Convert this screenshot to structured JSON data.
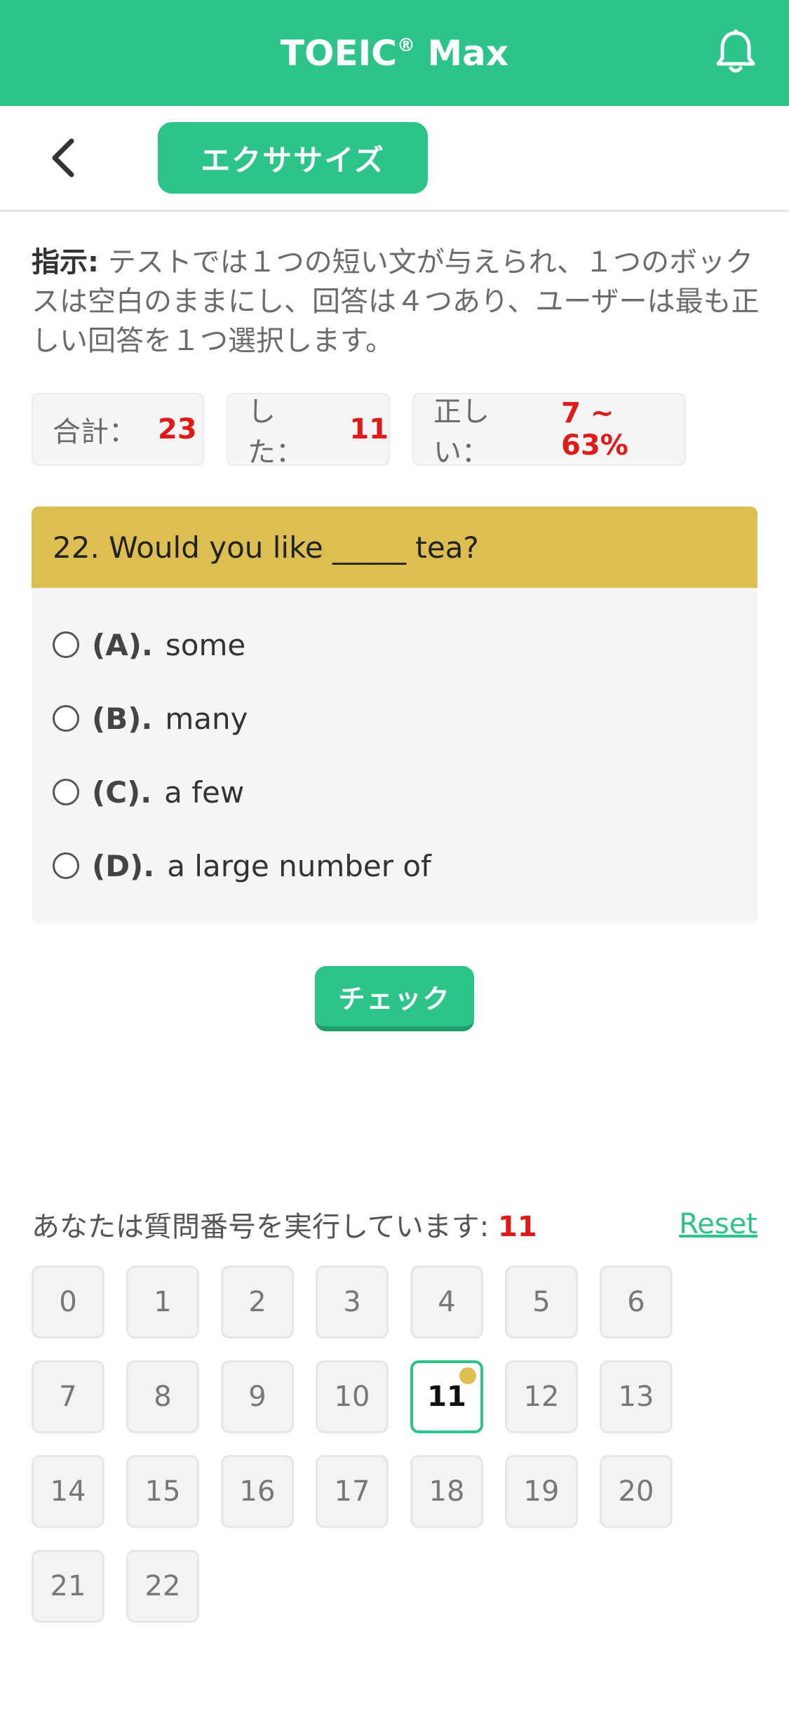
{
  "colors": {
    "brand": "#2dc48a",
    "accent": "#dcbf50",
    "highlight": "#e01919"
  },
  "header": {
    "title": "TOEIC",
    "title_reg": "®",
    "title_suffix": " Max",
    "bell_icon": "bell-icon"
  },
  "subheader": {
    "back_icon": "chevron-left-icon",
    "exercise_label": "エクササイズ"
  },
  "instruction": {
    "label": "指示:",
    "text": " テストでは１つの短い文が与えられ、１つのボックスは空白のままにし、回答は４つあり、ユーザーは最も正しい回答を１つ選択します。"
  },
  "stats": {
    "total_label": "合計：",
    "total_value": "23",
    "done_label": "した：",
    "done_value": "11",
    "correct_label": "正しい：",
    "correct_value": "7 ~ 63%"
  },
  "question": {
    "text": "22. Would you like _____ tea?",
    "options": [
      {
        "letter": "(A).",
        "text": "some"
      },
      {
        "letter": "(B).",
        "text": "many"
      },
      {
        "letter": "(C).",
        "text": "a few"
      },
      {
        "letter": "(D).",
        "text": "a large number of"
      }
    ]
  },
  "check_label": "チェック",
  "progress": {
    "label": "あなたは質問番号を実行しています: ",
    "current": "11",
    "reset_label": "Reset"
  },
  "questions_grid": [
    "0",
    "1",
    "2",
    "3",
    "4",
    "5",
    "6",
    "7",
    "8",
    "9",
    "10",
    "11",
    "12",
    "13",
    "14",
    "15",
    "16",
    "17",
    "18",
    "19",
    "20",
    "21",
    "22"
  ]
}
